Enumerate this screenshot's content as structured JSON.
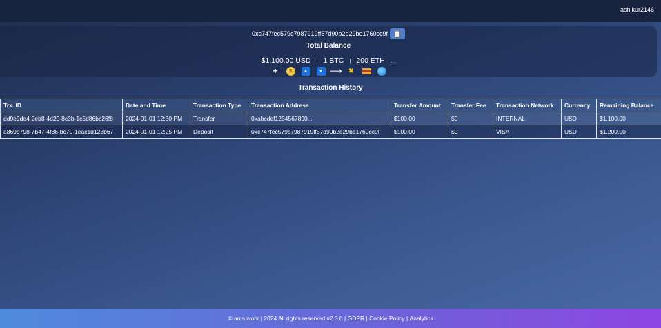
{
  "header": {
    "username": "ashikur2146"
  },
  "wallet": {
    "address": "0xc747fec579c7987919ff57d90b2e29be1760cc9f",
    "copy_icon": "📋",
    "total_title": "Total Balance",
    "balances": {
      "usd": "$1,100.00 USD",
      "btc": "1 BTC",
      "eth": "200 ETH",
      "more": "..."
    },
    "separator": "|",
    "actions": {
      "add": "+",
      "deposit_icon": "$",
      "upload_icon": "▲",
      "download_icon": "▼",
      "transfer_icon": "⟶",
      "exchange_icon": "✖",
      "card_icon": "card-icon",
      "globe_icon": "globe-icon"
    }
  },
  "history": {
    "title": "Transaction History",
    "columns": [
      "Trx. ID",
      "Date and Time",
      "Transaction Type",
      "Transaction Address",
      "Transfer Amount",
      "Transfer Fee",
      "Transaction Network",
      "Currency",
      "Remaining Balance"
    ],
    "rows": [
      [
        "dd9e9de4-2eb8-4d20-8c3b-1c5d86bc26f8",
        "2024-01-01 12:30 PM",
        "Transfer",
        "0xabcdef1234567890...",
        "$100.00",
        "$0",
        "INTERNAL",
        "USD",
        "$1,100.00"
      ],
      [
        "a869d798-7b47-4f86-bc70-1eac1d123b67",
        "2024-01-01 12:25 PM",
        "Deposit",
        "0xc747fec579c7987919ff57d90b2e29be1760cc9f",
        "$100.00",
        "$0",
        "VISA",
        "USD",
        "$1,200.00"
      ]
    ]
  },
  "footer": {
    "copyright": "© arcs.work | 2024 All rights reserved v2.3.0 |",
    "sep": "|",
    "links": [
      "GDPR",
      "Cookie Policy",
      "Analytics"
    ]
  }
}
